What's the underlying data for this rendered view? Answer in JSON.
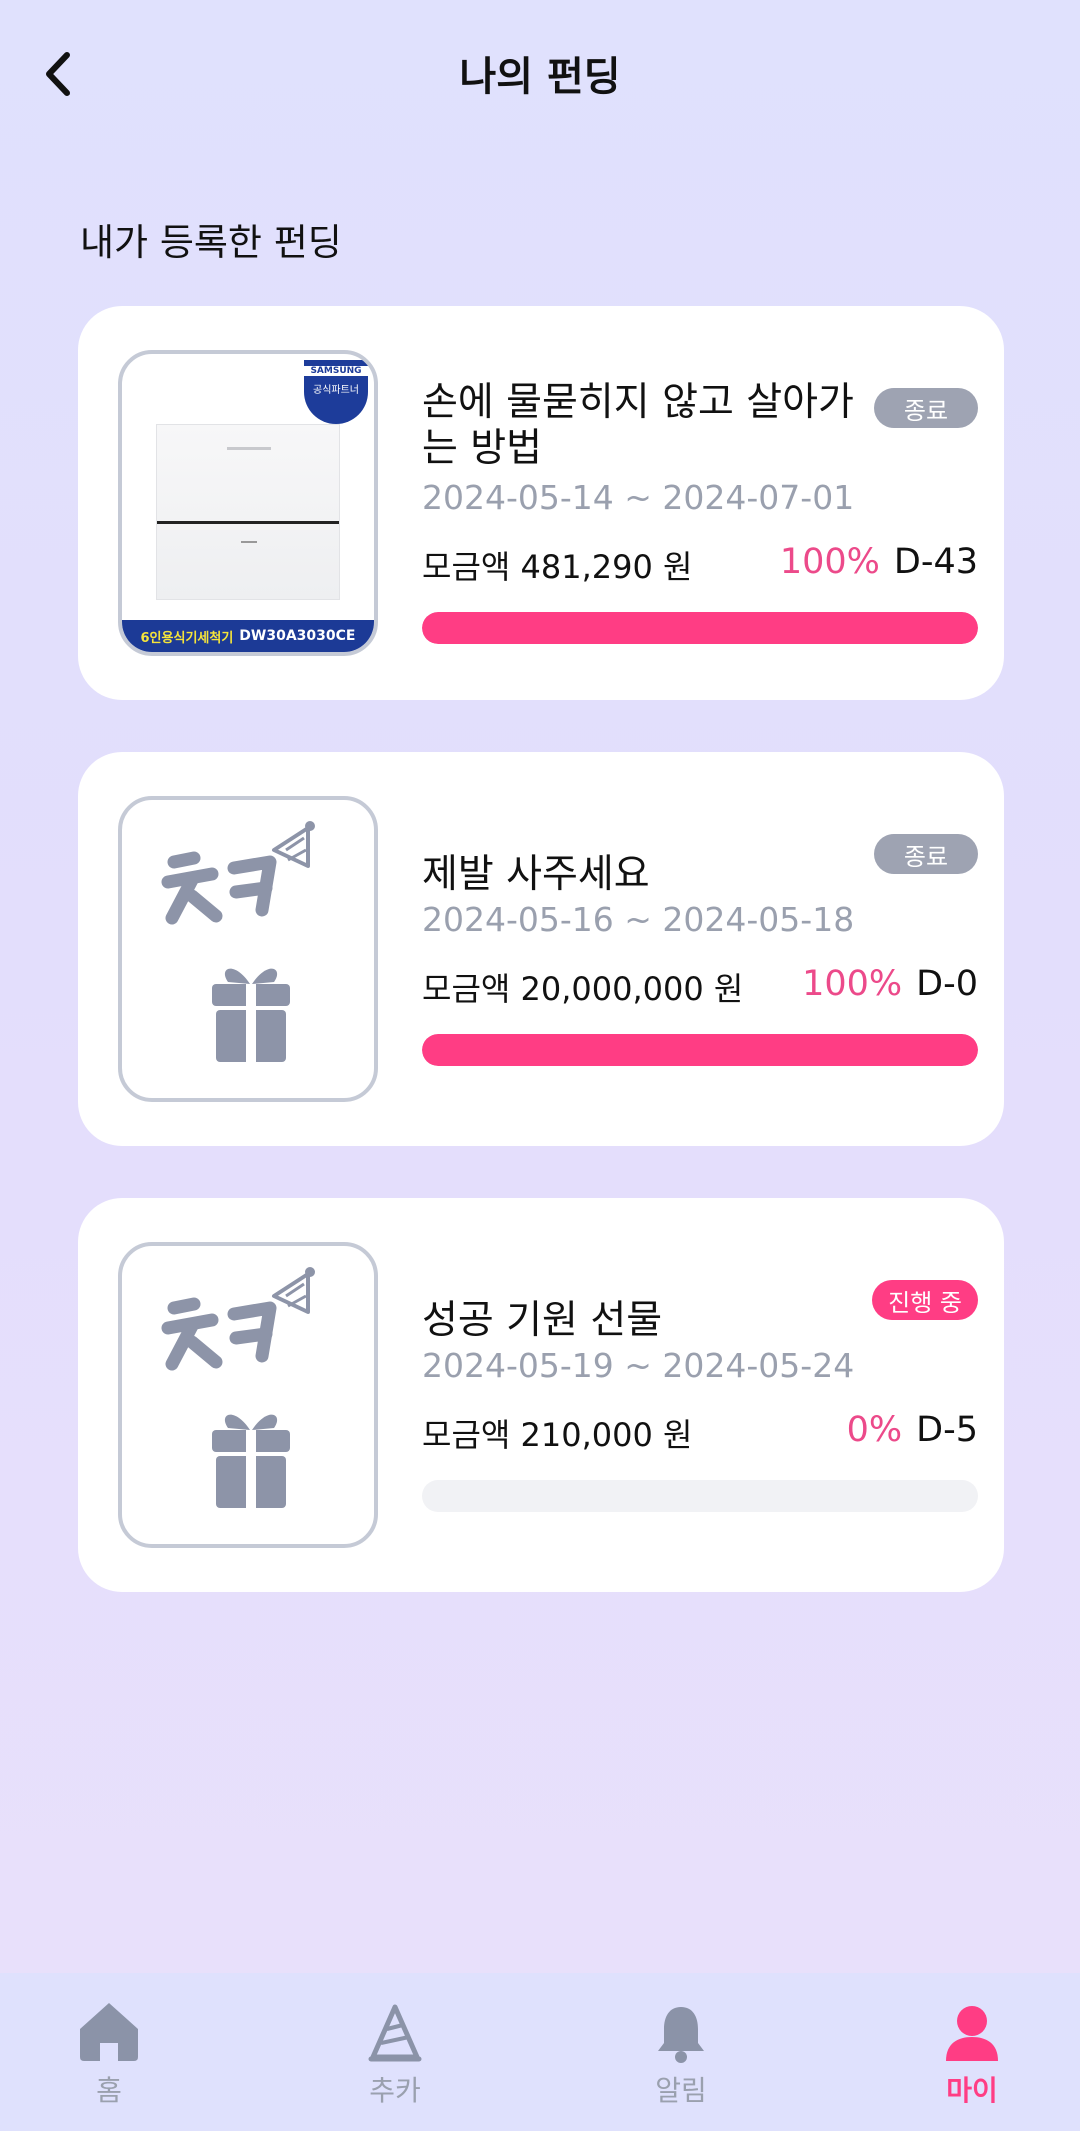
{
  "header": {
    "title": "나의 펀딩"
  },
  "section": {
    "title": "내가 등록한 펀딩"
  },
  "cards": [
    {
      "title": "손에 물묻히지 않고 살아가는 방법",
      "date": "2024-05-14 ~ 2024-07-01",
      "status": "종료",
      "amount": "모금액 481,290 원",
      "percent": "100%",
      "dday": "D-43",
      "progress": 1.0,
      "thumb": {
        "type": "product",
        "brand": "SAMSUNG",
        "badge": "공식파트너",
        "caption_ko": "6인용식기세척기",
        "caption_model": "DW30A3030CE"
      }
    },
    {
      "title": "제발 사주세요",
      "date": "2024-05-16 ~ 2024-05-18",
      "status": "종료",
      "amount": "모금액 20,000,000 원",
      "percent": "100%",
      "dday": "D-0",
      "progress": 1.0,
      "thumb": {
        "type": "placeholder",
        "logo_text": "ㅊㅋ"
      }
    },
    {
      "title": "성공 기원 선물",
      "date": "2024-05-19 ~ 2024-05-24",
      "status": "진행 중",
      "amount": "모금액 210,000 원",
      "percent": "0%",
      "dday": "D-5",
      "progress": 0.0,
      "thumb": {
        "type": "placeholder",
        "logo_text": "ㅊㅋ"
      }
    }
  ],
  "tabbar": {
    "items": [
      {
        "label": "홈",
        "icon": "home-icon",
        "active": false
      },
      {
        "label": "추카",
        "icon": "party-hat-icon",
        "active": false
      },
      {
        "label": "알림",
        "icon": "bell-icon",
        "active": false
      },
      {
        "label": "마이",
        "icon": "user-icon",
        "active": true
      }
    ]
  },
  "colors": {
    "accent": "#ff3d84",
    "muted": "#9aa0ae",
    "badge_done": "#9ea3b2"
  }
}
